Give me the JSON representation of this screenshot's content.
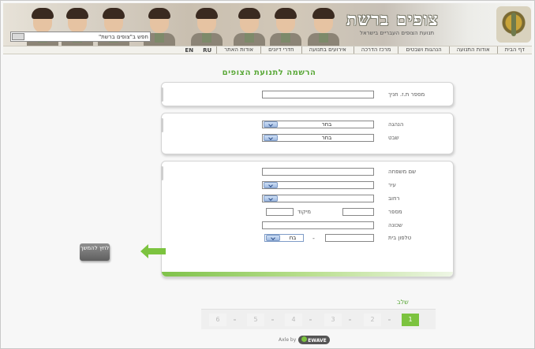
{
  "header": {
    "logo_title": "צופים ברשת",
    "logo_subtitle": "תנועת הצופים העבריים בישראל",
    "search_placeholder": "חפש ב\"צופים ברשת\""
  },
  "nav": {
    "items": [
      "דף הבית",
      "אודות התנועה",
      "הנהגות ושבטים",
      "מרכז הדרכה",
      "אירועים בתנועה",
      "חדרי דיונים",
      "אודות האתר"
    ],
    "languages": [
      "RU",
      "EN"
    ]
  },
  "page_title": "הרשמה לתנועת הצופים",
  "form": {
    "id_label": "מספר ת.ז. חניך",
    "region_label": "הנהגה",
    "region_value": "בחר",
    "tribe_label": "שבט",
    "tribe_value": "בחר",
    "last_name_label": "שם משפחה",
    "city_label": "עיר",
    "street_label": "רחוב",
    "number_label": "מספר",
    "zip_label": "מיקוד",
    "neighborhood_label": "שכונה",
    "phone_label": "טלפון בית",
    "phone_prefix_value": "בח",
    "phone_dash": "-"
  },
  "continue_button": "לחץ להמשך",
  "steps": {
    "label": "שלב",
    "items": [
      "1",
      "2",
      "3",
      "4",
      "5",
      "6"
    ],
    "active": "1"
  },
  "credit": {
    "text": "Axle by",
    "brand": "EWAVE"
  },
  "colors": {
    "accent_green": "#7cc33f",
    "title_green": "#5aa838"
  }
}
